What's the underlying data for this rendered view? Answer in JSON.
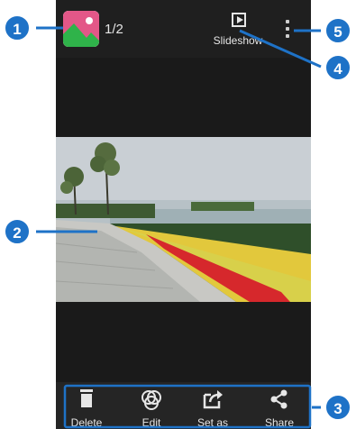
{
  "counter": "1/2",
  "slideshow_label": "Slideshow",
  "actions": [
    {
      "label": "Delete",
      "icon": "trash-icon"
    },
    {
      "label": "Edit",
      "icon": "edit-effects-icon"
    },
    {
      "label": "Set as",
      "icon": "set-as-icon"
    },
    {
      "label": "Share",
      "icon": "share-icon"
    }
  ],
  "callouts": [
    "1",
    "2",
    "3",
    "4",
    "5"
  ],
  "colors": {
    "accent": "#1e72c7",
    "background": "#1a1a1a",
    "gallery_icon_green": "#2fb34a",
    "gallery_icon_pink": "#e0457b"
  }
}
